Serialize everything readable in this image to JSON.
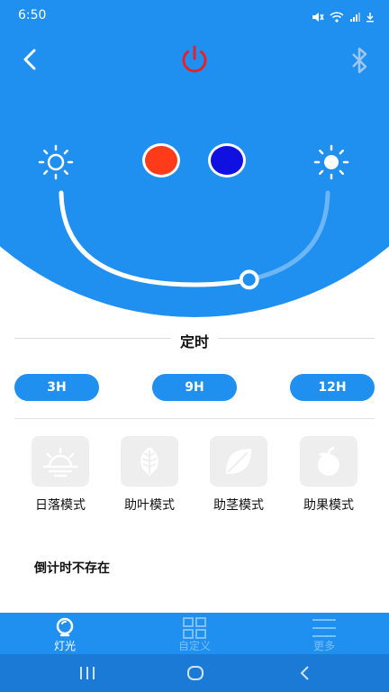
{
  "status_bar": {
    "time": "6:50",
    "icons": [
      "mute-icon",
      "wifi-icon",
      "signal-icon",
      "download-icon"
    ]
  },
  "header": {
    "back_icon": "chevron-left-icon",
    "power_icon": "power-icon",
    "bluetooth_icon": "bluetooth-icon"
  },
  "colors": {
    "primary": "#1f8ff0",
    "power": "#e8202a",
    "red_swatch": "#ff3b1a",
    "blue_swatch": "#1010e0"
  },
  "brightness": {
    "level": 0.65,
    "min_icon": "sun-low-icon",
    "max_icon": "sun-high-icon"
  },
  "timer": {
    "title": "定时",
    "options": [
      "3H",
      "9H",
      "12H"
    ]
  },
  "modes": [
    {
      "label": "日落模式",
      "icon": "sunset-icon"
    },
    {
      "label": "助叶模式",
      "icon": "leaf-pattern-icon"
    },
    {
      "label": "助茎模式",
      "icon": "leaf-icon"
    },
    {
      "label": "助果模式",
      "icon": "fruit-icon"
    }
  ],
  "countdown_text": "倒计时不存在",
  "bottom_nav": [
    {
      "label": "灯光",
      "icon": "lightbulb-icon",
      "active": true
    },
    {
      "label": "自定义",
      "icon": "grid-icon",
      "active": false
    },
    {
      "label": "更多",
      "icon": "menu-icon",
      "active": false
    }
  ],
  "system_nav": [
    "recents-icon",
    "home-icon",
    "back-icon"
  ]
}
